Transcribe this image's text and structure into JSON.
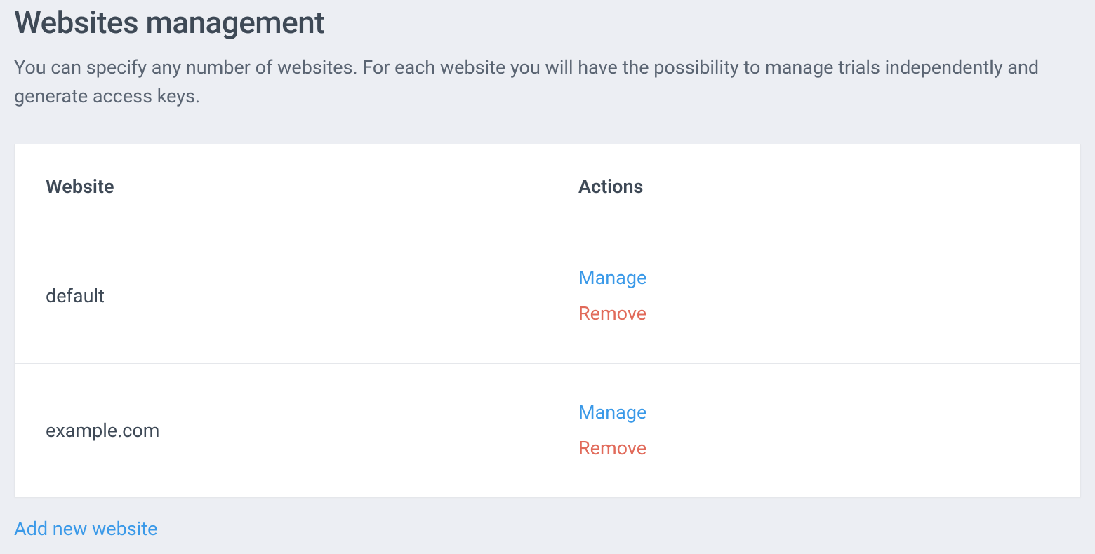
{
  "header": {
    "title": "Websites management",
    "description": "You can specify any number of websites. For each website you will have the possibility to manage trials independently and generate access keys."
  },
  "table": {
    "columns": {
      "website": "Website",
      "actions": "Actions"
    },
    "rows": [
      {
        "name": "default",
        "manage_label": "Manage",
        "remove_label": "Remove"
      },
      {
        "name": "example.com",
        "manage_label": "Manage",
        "remove_label": "Remove"
      }
    ]
  },
  "footer": {
    "add_link": "Add new website"
  },
  "colors": {
    "link": "#3a99e8",
    "danger": "#e16a5a",
    "bg": "#eceef3",
    "text": "#3e4956"
  }
}
